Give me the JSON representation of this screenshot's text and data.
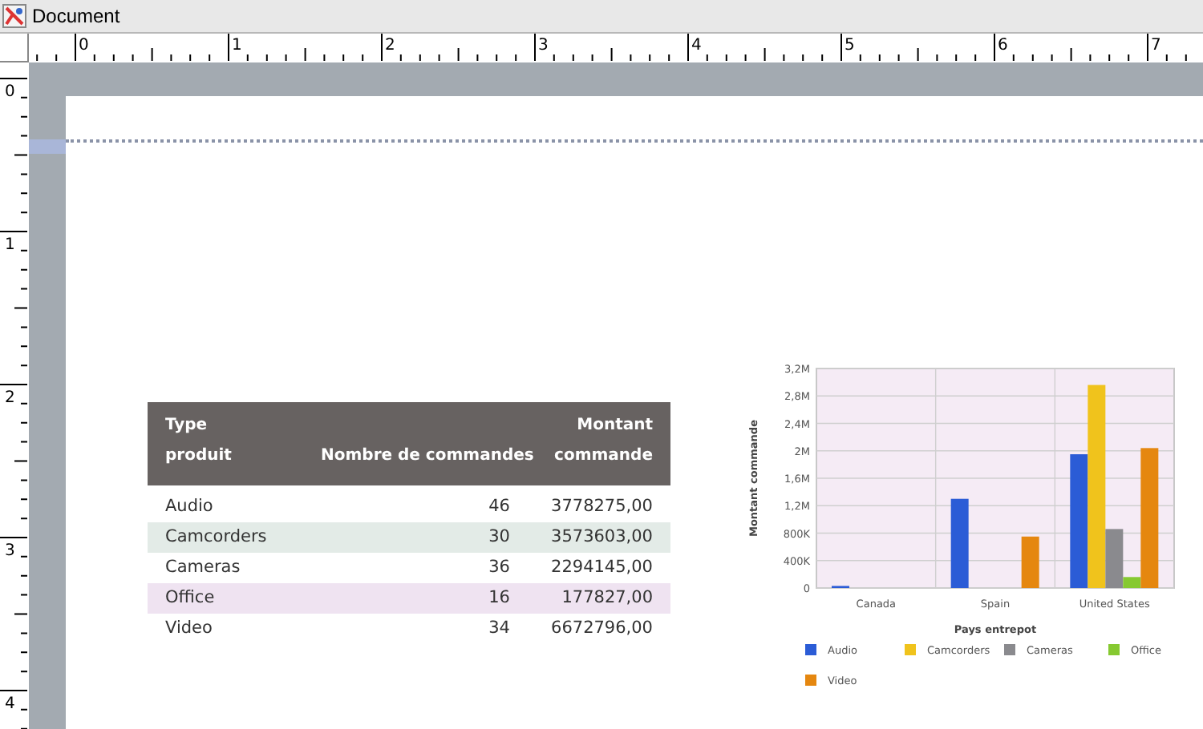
{
  "window": {
    "title": "Document"
  },
  "rulers": {
    "horizontal": [
      "0",
      "1",
      "2",
      "3",
      "4",
      "5",
      "6",
      "7"
    ],
    "vertical": [
      "0",
      "1",
      "2",
      "3",
      "4"
    ]
  },
  "table": {
    "columns": [
      {
        "label": "Type produit"
      },
      {
        "label": "Nombre de commandes"
      },
      {
        "label": "Montant commande"
      }
    ],
    "rows": [
      {
        "cells": [
          "Audio",
          "46",
          "3778275,00"
        ],
        "color": "#ffffff"
      },
      {
        "cells": [
          "Camcorders",
          "30",
          "3573603,00"
        ],
        "color": "#e3ebe7"
      },
      {
        "cells": [
          "Cameras",
          "36",
          "2294145,00"
        ],
        "color": "#ffffff"
      },
      {
        "cells": [
          "Office",
          "16",
          "177827,00"
        ],
        "color": "#efe3f1"
      },
      {
        "cells": [
          "Video",
          "34",
          "6672796,00"
        ],
        "color": "#ffffff"
      }
    ]
  },
  "chart": {
    "chart_data": {
      "type": "bar",
      "xlabel": "Pays entrepot",
      "ylabel": "Montant commande",
      "categories": [
        "Canada",
        "Spain",
        "United States"
      ],
      "series": [
        {
          "name": "Audio",
          "color": "#2b5cd6",
          "values": [
            30000,
            1300000,
            1950000
          ]
        },
        {
          "name": "Camcorders",
          "color": "#f0c31c",
          "values": [
            null,
            null,
            2960000
          ]
        },
        {
          "name": "Cameras",
          "color": "#8a8a8e",
          "values": [
            null,
            null,
            860000
          ]
        },
        {
          "name": "Office",
          "color": "#86c931",
          "values": [
            null,
            null,
            160000
          ]
        },
        {
          "name": "Video",
          "color": "#e5870f",
          "values": [
            null,
            750000,
            2040000
          ]
        }
      ],
      "ylim": [
        0,
        3200000
      ],
      "grid": true,
      "legend": "bottom",
      "yticks": [
        {
          "value": 0,
          "label": "0"
        },
        {
          "value": 400000,
          "label": "400K"
        },
        {
          "value": 800000,
          "label": "800K"
        },
        {
          "value": 1200000,
          "label": "1,2M"
        },
        {
          "value": 1600000,
          "label": "1,6M"
        },
        {
          "value": 2000000,
          "label": "2M"
        },
        {
          "value": 2400000,
          "label": "2,4M"
        },
        {
          "value": 2800000,
          "label": "2,8M"
        },
        {
          "value": 3200000,
          "label": "3,2M"
        }
      ]
    }
  }
}
